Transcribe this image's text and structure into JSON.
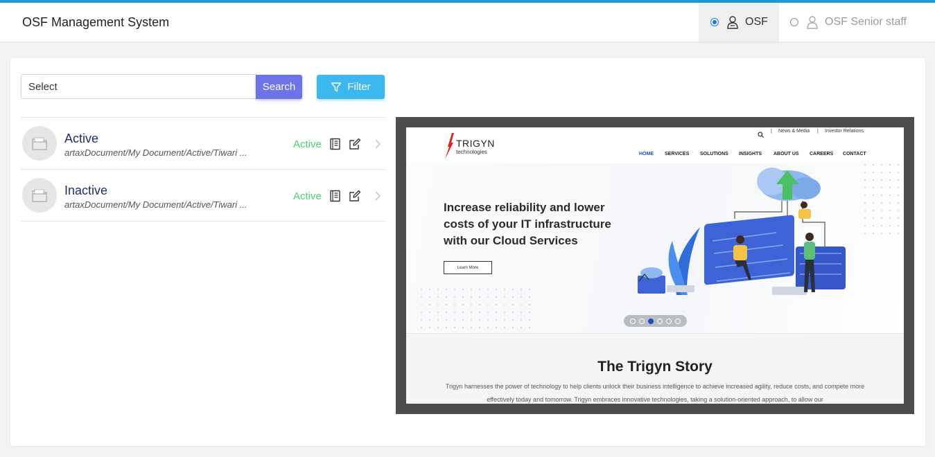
{
  "header": {
    "app_title": "OSF Management System",
    "roles": [
      {
        "label": "OSF",
        "selected": true,
        "icon": "user-icon"
      },
      {
        "label": "OSF Senior staff",
        "selected": false,
        "icon": "user-icon"
      }
    ]
  },
  "toolbar": {
    "search_value": "Select",
    "search_label": "Search",
    "filter_label": "Filter"
  },
  "colors": {
    "accent_top": "#1e9ad6",
    "search_button": "#6c74e8",
    "filter_button": "#3db8ef",
    "status_active": "#4cd174",
    "title_text": "#1c2f6b"
  },
  "documents": [
    {
      "title": "Active",
      "path": "artaxDocument/My Document/Active/Tiwari ...",
      "status": "Active"
    },
    {
      "title": "Inactive",
      "path": "artaxDocument/My Document/Active/Tiwari ...",
      "status": "Active"
    }
  ],
  "preview": {
    "logo_name": "TRIGYN",
    "logo_sub": "technologies",
    "util_links": [
      "News & Media",
      "Investor Relations"
    ],
    "nav": [
      "HOME",
      "SERVICES",
      "SOLUTIONS",
      "INSIGHTS",
      "ABOUT US",
      "CAREERS",
      "CONTACT"
    ],
    "hero_text": "Increase reliability and lower costs of your IT infrastructure with our Cloud Services",
    "learn_more": "Learn More",
    "slider_count": 6,
    "slider_active": 3,
    "story_title": "The Trigyn Story",
    "story_text": "Trigyn harnesses the power of technology to help clients unlock their business intelligence to achieve increased agility, reduce costs, and compete more effectively today and tomorrow. Trigyn embraces innovative technologies, taking a solution-oriented approach, to allow our"
  }
}
